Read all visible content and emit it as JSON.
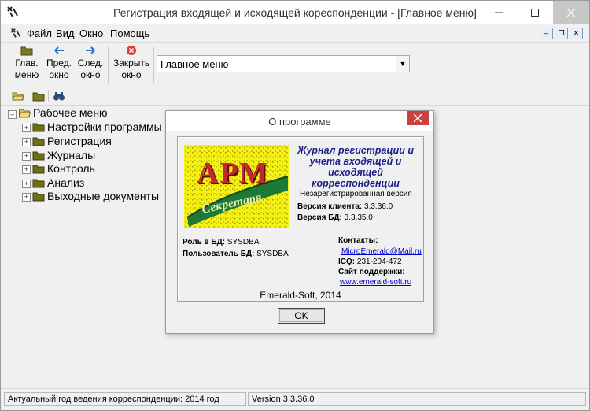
{
  "window": {
    "title": "Регистрация входящей и исходящей кореспонденции - [Главное меню]",
    "controls": [
      "–",
      "❐",
      "✕"
    ]
  },
  "menu": [
    "Файл",
    "Вид",
    "Окно",
    "Помощь"
  ],
  "toolbar": {
    "main_menu": "Глав. меню",
    "prev_window": "Пред. окно",
    "next_window": "След. окно",
    "close_window": "Закрыть окно",
    "combo_value": "Главное меню"
  },
  "tree": {
    "root": "Рабочее меню",
    "items": [
      "Настройки программы",
      "Регистрация",
      "Журналы",
      "Контроль",
      "Анализ",
      "Выходные документы"
    ]
  },
  "status": {
    "left": "Актуальный год ведения корреспонденции: 2014 год",
    "right": "Version 3.3.36.0"
  },
  "about": {
    "title": "О программе",
    "app_name_1": "Журнал регистрации и",
    "app_name_2": "учета входящей и",
    "app_name_3": "исходящей",
    "app_name_4": "корреспонденции",
    "unregistered": "Незарегистрированная версия",
    "client_version_label": "Версия клиента:",
    "client_version": "3.3.36.0",
    "db_version_label": "Версия БД:",
    "db_version": "3.3.35.0",
    "logo_top": "АРМ",
    "logo_bottom": "Секретаря",
    "role_label": "Роль в БД:",
    "role": "SYSDBA",
    "user_label": "Пользователь БД:",
    "user": "SYSDBA",
    "contacts_label": "Контакты:",
    "email": "MicroEmerald@Mail.ru",
    "icq_label": "ICQ:",
    "icq": "231-204-472",
    "support_label": "Сайт поддержки:",
    "site": "www.emerald-soft.ru",
    "company": "Emerald-Soft, 2014",
    "ok": "OK"
  }
}
